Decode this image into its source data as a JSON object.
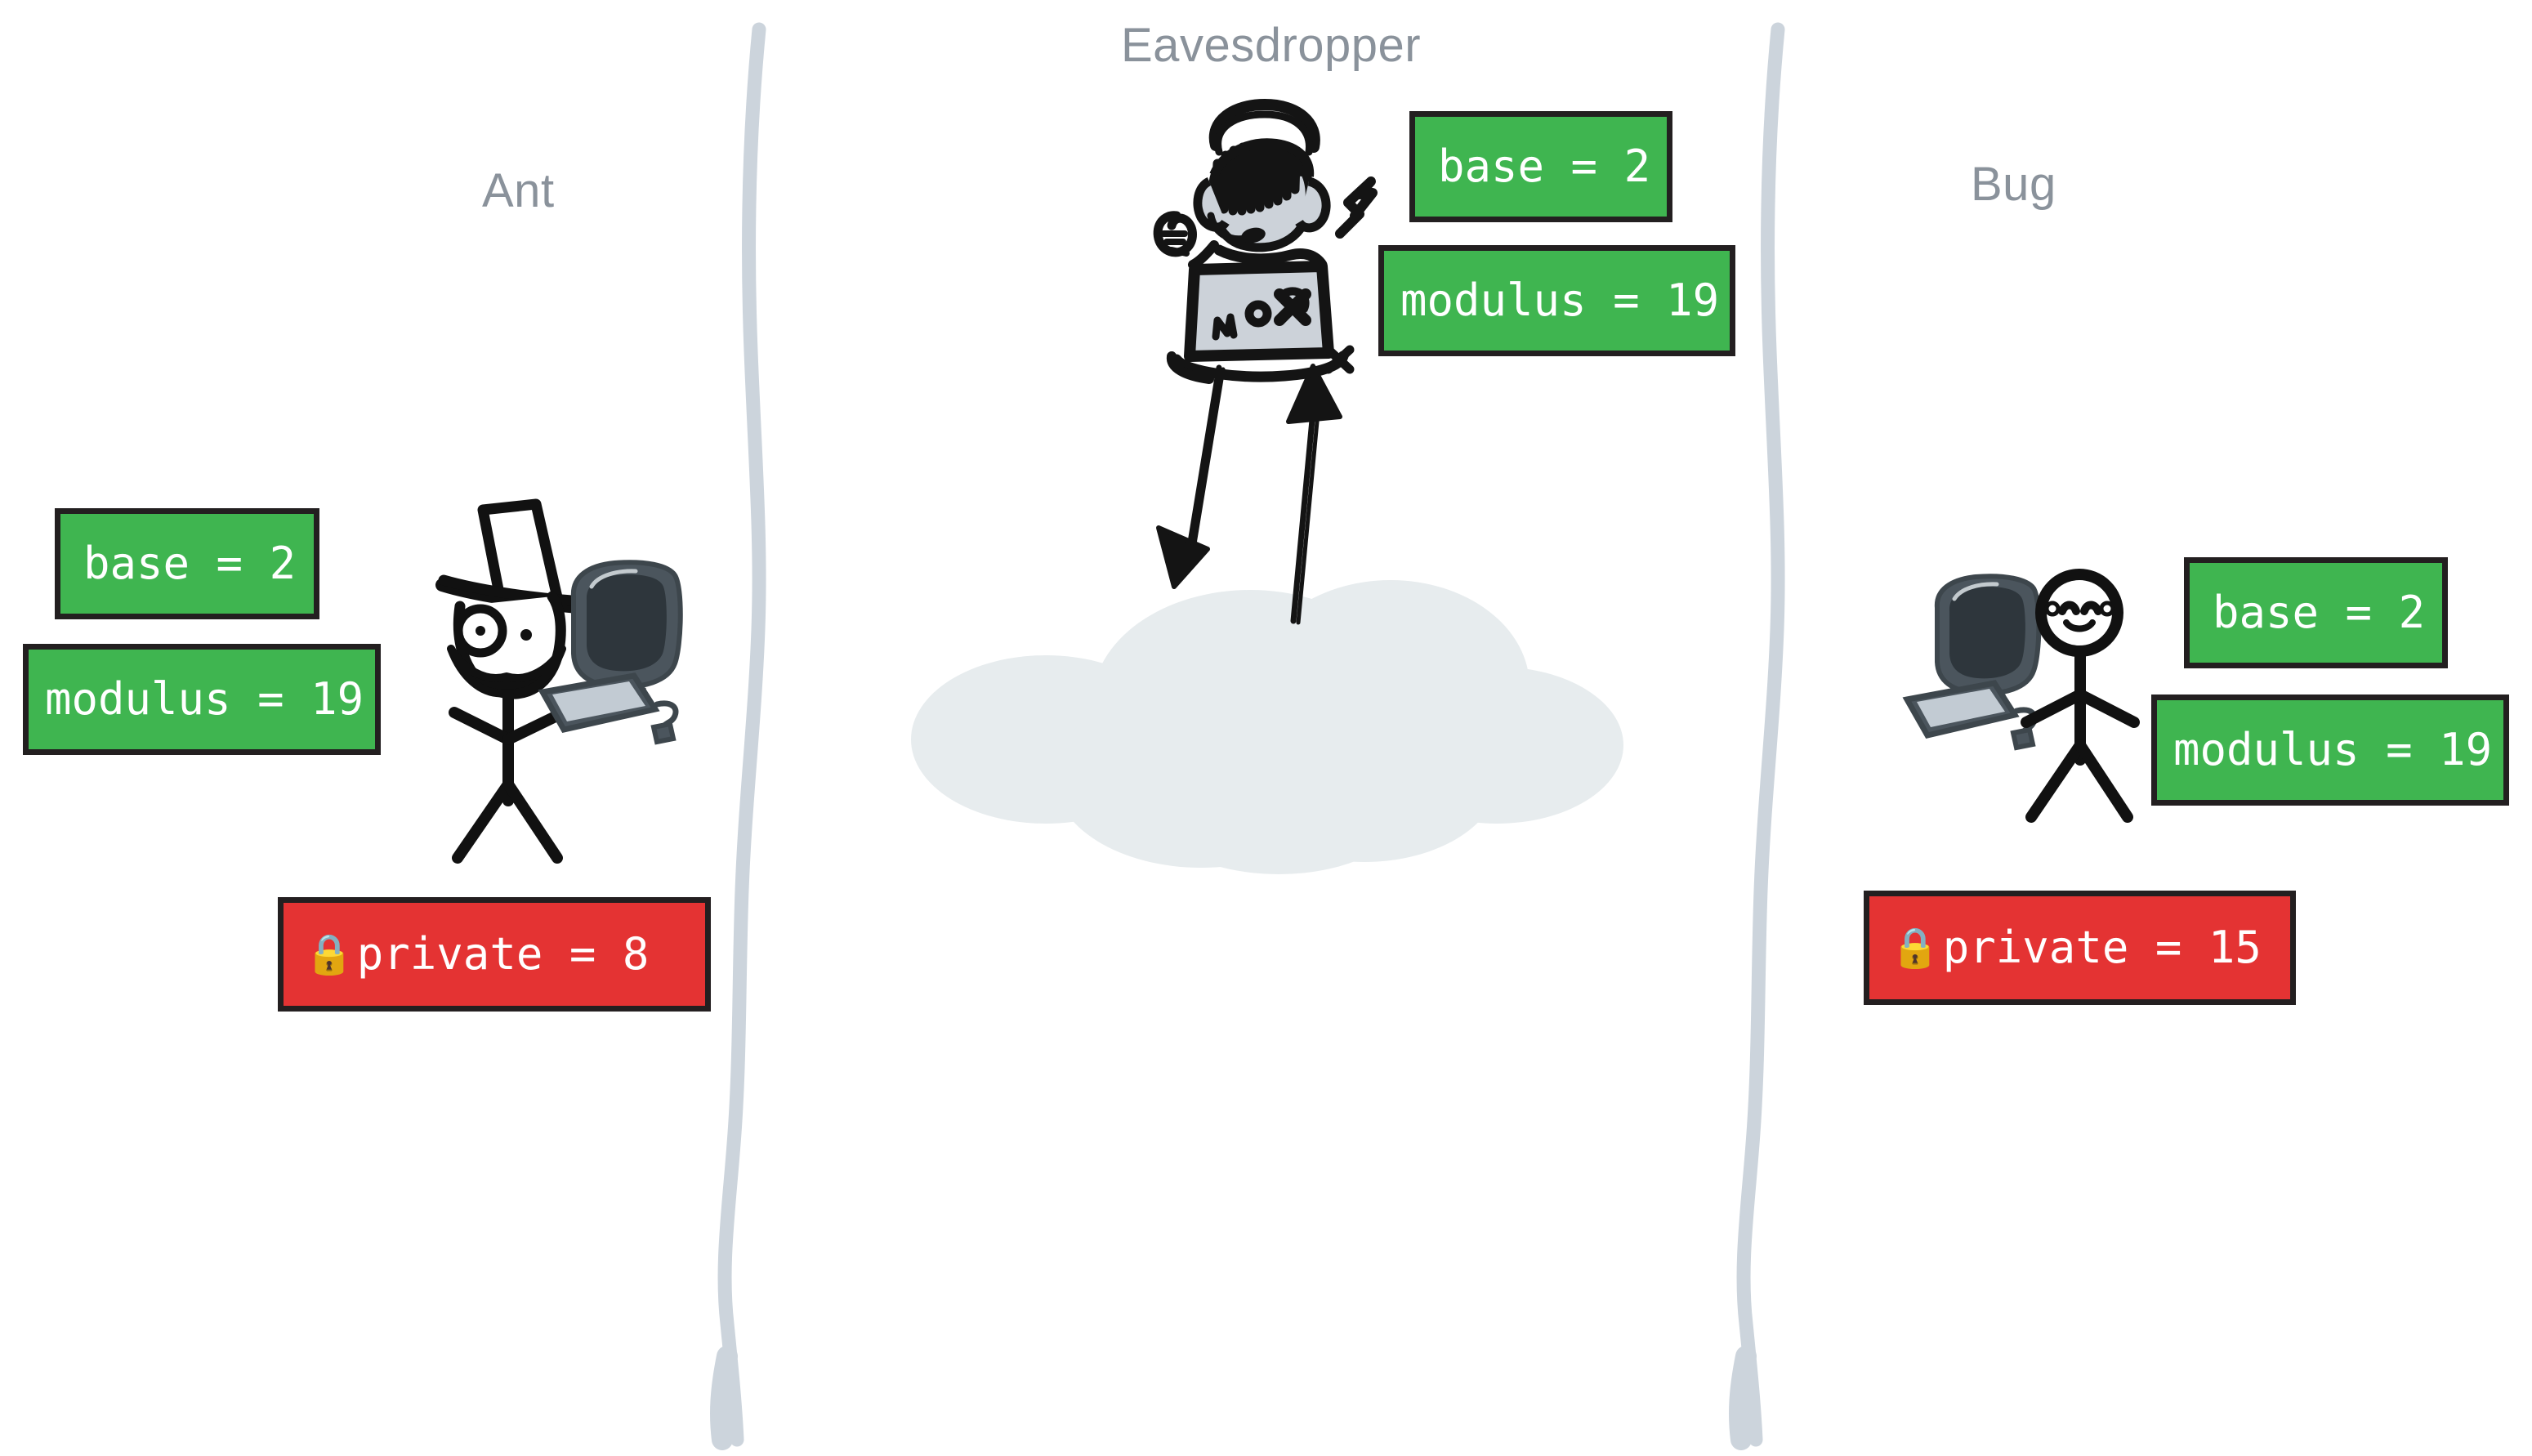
{
  "diagram": {
    "title_context": "Diffie-Hellman key exchange over a public channel with an eavesdropper",
    "background_color": "#ffffff",
    "accent_public_color": "#3fb550",
    "accent_private_color": "#e43333",
    "label_color": "#8a929b",
    "divider_color": "#ccd4dc",
    "cloud_color": "#e7ecee",
    "ink_color": "#231f20"
  },
  "parties": {
    "left": {
      "label": "Ant",
      "figure_name": "ant-stick-figure-with-top-hat-monocle-mustache",
      "computer_name": "desktop-computer-monitor-keyboard-mouse",
      "public_values": [
        {
          "text": "base = 2",
          "key": "base",
          "value": "2",
          "color": "#3fb550"
        },
        {
          "text": "modulus = 19",
          "key": "modulus",
          "value": "19",
          "color": "#3fb550"
        }
      ],
      "private_value": {
        "lock": "🔒",
        "text": "private = 8",
        "key": "private",
        "value": "8",
        "color": "#e43333"
      }
    },
    "center": {
      "label": "Eavesdropper",
      "figure_name": "hacker-with-headphones-and-laptop",
      "public_values": [
        {
          "text": "base = 2",
          "key": "base",
          "value": "2",
          "color": "#3fb550"
        },
        {
          "text": "modulus = 19",
          "key": "modulus",
          "value": "19",
          "color": "#3fb550"
        }
      ],
      "private_value": null,
      "channel_name": "public-network-cloud",
      "arrows": [
        {
          "name": "arrow-down-to-cloud",
          "direction": "down"
        },
        {
          "name": "arrow-up-from-cloud",
          "direction": "up"
        }
      ]
    },
    "right": {
      "label": "Bug",
      "figure_name": "bug-stick-figure-smiling",
      "computer_name": "desktop-computer-monitor-keyboard-mouse",
      "public_values": [
        {
          "text": "base = 2",
          "key": "base",
          "value": "2",
          "color": "#3fb550"
        },
        {
          "text": "modulus = 19",
          "key": "modulus",
          "value": "19",
          "color": "#3fb550"
        }
      ],
      "private_value": {
        "lock": "🔒",
        "text": "private = 15",
        "key": "private",
        "value": "15",
        "color": "#e43333"
      }
    }
  }
}
